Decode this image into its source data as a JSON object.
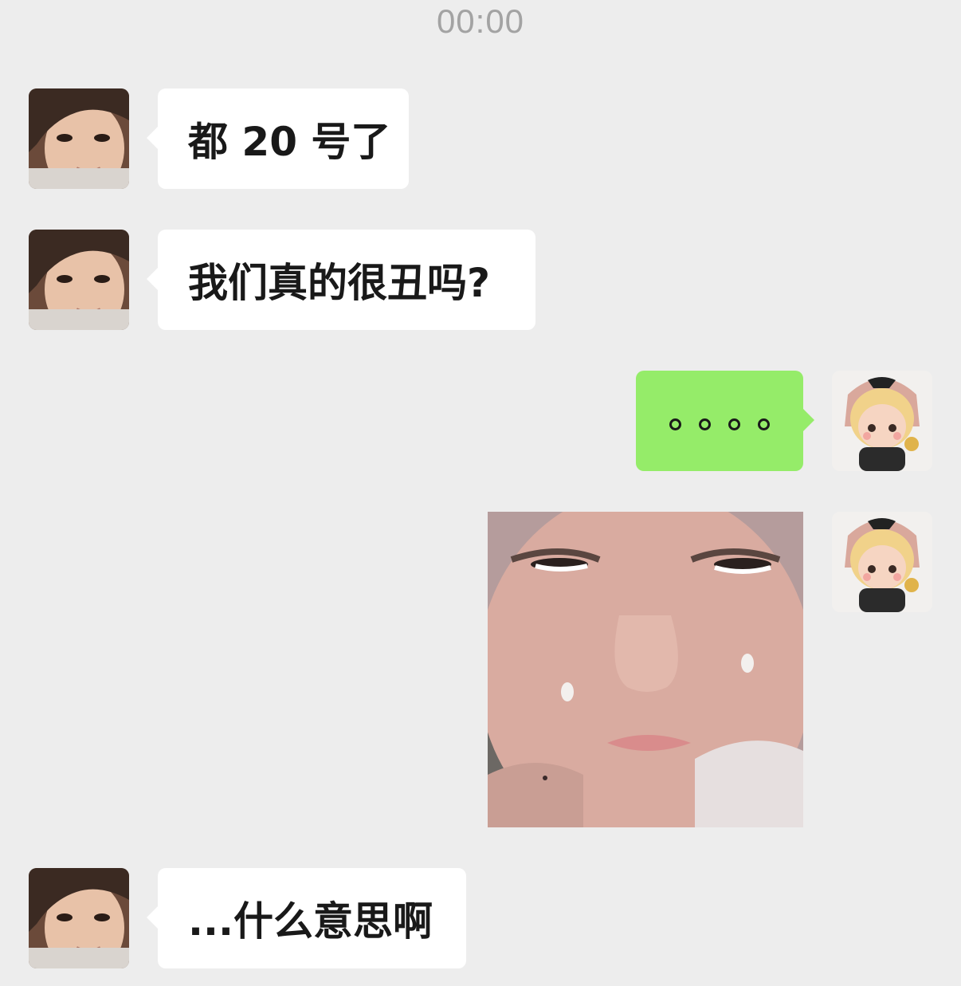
{
  "chat": {
    "timestamp": "00:00",
    "messages": [
      {
        "side": "in",
        "type": "text",
        "text": "都 20 号了"
      },
      {
        "side": "in",
        "type": "text",
        "text": "我们真的很丑吗?"
      },
      {
        "side": "out",
        "type": "text",
        "text": "。。。。"
      },
      {
        "side": "out",
        "type": "image",
        "content": "crying face sticker"
      },
      {
        "side": "in",
        "type": "text",
        "text": "...什么意思啊"
      }
    ]
  },
  "colors": {
    "background": "#ededed",
    "incoming_bubble": "#ffffff",
    "outgoing_bubble": "#95ec69",
    "timestamp_text": "#a3a3a3"
  },
  "icons": {
    "contact_avatar": "girl-photo-avatar",
    "self_avatar": "doll-figure-avatar"
  }
}
